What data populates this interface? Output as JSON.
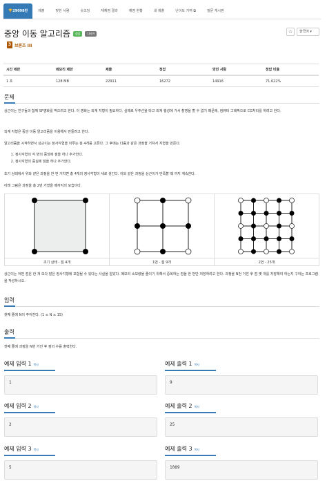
{
  "tabs": [
    {
      "label": "29098번",
      "active": true
    },
    {
      "label": "제출"
    },
    {
      "label": "맞힌 사람"
    },
    {
      "label": "숏코딩"
    },
    {
      "label": "재채점 결과"
    },
    {
      "label": "채점 현황"
    },
    {
      "label": "내 제출"
    },
    {
      "label": "난이도 기여",
      "external": true
    },
    {
      "label": "질문 게시판"
    }
  ],
  "problem": {
    "title": "중앙 이동 알고리즘",
    "badges": [
      "성공",
      "다국어"
    ],
    "tier_icon": "3",
    "tier": "브론즈 III"
  },
  "controls": {
    "star": "☆",
    "language": "한국어 ▾"
  },
  "info_table": {
    "headers": [
      "시간 제한",
      "메모리 제한",
      "제출",
      "정답",
      "맞힌 사람",
      "정답 비율"
    ],
    "row": [
      "1 초",
      "128 MB",
      "22911",
      "16272",
      "14916",
      "71.622%"
    ]
  },
  "sections": {
    "problem": "문제",
    "input": "입력",
    "output": "출력"
  },
  "problem_text": {
    "p1": "상근이는 친구들과 함께 SF영화를 찍으려고 한다. 이 영화는 외계 지형이 필요하다. 실제로 우주선을 타고 외계 행성에 가서 촬영을 할 수 없기 때문에, 컴퓨터 그래픽으로 CG처리를 하려고 한다.",
    "p2": "외계 지형은 중앙 이동 알고리즘을 이용해서 만들려고 한다.",
    "p3": "알고리즘을 시작하면서 상근이는 정사각형을 이루는 점 4개를 고른다. 그 후에는 다음과 같은 과정을 거쳐서 지형을 만든다.",
    "steps": [
      "정사각형의 각 변의 중앙에 점을 하나 추가한다.",
      "정사각형의 중심에 점을 하나 추가한다."
    ],
    "p4": "초기 상태에서 위와 같은 과정을 한 번 거치면 총 4개의 정사각형이 새로 생긴다. 이와 같은 과정을 상근이가 만족할 때 까지 계속한다.",
    "p5": "아래 그림은 과정을 총 2번 거쳤을 때까지의 모습이다.",
    "captions": [
      "초기 상태 - 점 4개",
      "1번 - 점 9개",
      "2번 - 25개"
    ],
    "p6": "상근이는 어떤 점은 한 개 보다 많은 정사각형에 포함될 수 있다는 사실을 알았다. 메모리 소모량을 줄이기 위해서 중복하는 점을 한 번만 저장하려고 한다. 과정을 N번 거친 후 점 몇 개를 저장해야 하는지 구하는 프로그램을 작성하시오."
  },
  "input_text": "첫째 줄에 N이 주어진다. (1 ≤ N ≤ 15)",
  "output_text": "첫째 줄에 과정을 N번 거친 후 점의 수를 출력한다.",
  "copy_label": "복사",
  "examples": [
    {
      "in_title": "예제 입력 1",
      "out_title": "예제 출력 1",
      "in": "1",
      "out": "9"
    },
    {
      "in_title": "예제 입력 2",
      "out_title": "예제 출력 2",
      "in": "2",
      "out": "25"
    },
    {
      "in_title": "예제 입력 3",
      "out_title": "예제 출력 3",
      "in": "5",
      "out": "1089"
    }
  ],
  "colors": {
    "accent": "#337ab7",
    "success": "#5cb85c",
    "bronze": "#ad5600"
  }
}
